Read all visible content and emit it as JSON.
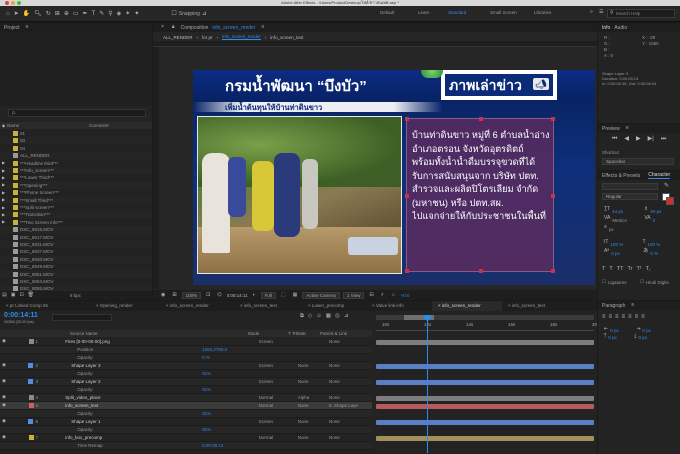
{
  "app": {
    "title": "Adobe After Effects - /Users/ProductDesktop/ไฟล์/ข่าวสนเทศ.aep *"
  },
  "toolbar": {
    "snapping": "Snapping",
    "workspaces": [
      "Default",
      "Learn",
      "Standard",
      "Small Screen",
      "Libraries"
    ],
    "active_workspace": "Standard",
    "search_placeholder": "Search Help"
  },
  "project": {
    "title": "Project",
    "search_placeholder": "ρ.",
    "col_name": "Name",
    "col_comment": "Comment",
    "items": [
      {
        "name": "01",
        "color": "#c9b23a"
      },
      {
        "name": "03",
        "color": "#c9b23a"
      },
      {
        "name": "04",
        "color": "#c9b23a"
      },
      {
        "name": "ALL_RENDER",
        "color": "#9a9a9a"
      },
      {
        "name": "***Headline third***",
        "color": "#c9b23a"
      },
      {
        "name": "***Info_screen***",
        "color": "#c9b23a"
      },
      {
        "name": "***Lower Third***",
        "color": "#c9b23a"
      },
      {
        "name": "***Opening***",
        "color": "#c9b23a"
      },
      {
        "name": "***Phone Screen***",
        "color": "#c9b23a"
      },
      {
        "name": "***Small Third***",
        "color": "#c9b23a"
      },
      {
        "name": "***Split screen***",
        "color": "#c9b23a"
      },
      {
        "name": "***Transition***",
        "color": "#c9b23a"
      },
      {
        "name": "***Two Screen info***",
        "color": "#c9b23a"
      },
      {
        "name": "DSC_8015.MOV",
        "color": "#9a9a9a"
      },
      {
        "name": "DSC_8017.MOV",
        "color": "#9a9a9a"
      },
      {
        "name": "DSC_8031.MOV",
        "color": "#9a9a9a"
      },
      {
        "name": "DSC_8037.MOV",
        "color": "#9a9a9a"
      },
      {
        "name": "DSC_8040.MOV",
        "color": "#9a9a9a"
      },
      {
        "name": "DSC_8049.MOV",
        "color": "#9a9a9a"
      },
      {
        "name": "DSC_8051.MOV",
        "color": "#9a9a9a"
      },
      {
        "name": "DSC_8053.MOV",
        "color": "#9a9a9a"
      },
      {
        "name": "DSC_8055.MOV",
        "color": "#9a9a9a"
      }
    ],
    "footer_bpc": "8 bpc"
  },
  "composition": {
    "title": "Composition",
    "name": "info_screen_render",
    "breadcrumbs": [
      "ALL_RENDER",
      "for pr",
      "info_screen_render",
      "info_screen_text"
    ],
    "zoom": "100%",
    "timecode": "0:00:14:11",
    "quality": "Full",
    "camera": "Active Camera",
    "views": "1 View",
    "exposure": "+0.0"
  },
  "news": {
    "headline": "กรมน้ำพัฒนา “บึงบัว”",
    "subheadline": "เพิ่มน้ำต้นทุนให้บ้านท่าดินขาว",
    "tag": "ภาพเล่าข่าว",
    "body": [
      "บ้านท่าดินขาว หมู่ที่ 6 ตำบลน้ำอ่าง",
      "อำเภอตรอน จังหวัดอุตรดิตถ์",
      "พร้อมทั้งน้ำน้ำดื่มบรรจุขวดที่ได้",
      "รับการสนับสนุนจาก บริษัท ปตท.",
      "สำรวจและผลิตปิโตรเลียม จำกัด",
      "(มหาชน) หรือ ปตท.สผ.",
      "ไปแจกจ่ายให้กับประชาชนในพื้นที่"
    ]
  },
  "info": {
    "title": "Info",
    "tab2": "Audio",
    "readouts": [
      "R :",
      "G :",
      "B :",
      "A : 0",
      "X : -28",
      "Y : 1060"
    ],
    "layer_lines": [
      "Shape Layer 3",
      "Duration: 0:00:05:13",
      "In: 0:00:00:16, Out: 0:00:06:04"
    ]
  },
  "preview": {
    "title": "Preview",
    "shortcut_label": "Shortcut",
    "shortcut_value": "Spacebar"
  },
  "character": {
    "tab1": "Effects & Presets",
    "tab2": "Character",
    "font_style": "Regular",
    "size_value": "44 px",
    "leading_value": "60 px",
    "kerning_value": "Metrics",
    "tracking_value": "0",
    "stroke_value": "px",
    "vscale": "100 %",
    "hscale": "100 %",
    "baseline": "0 px",
    "tsume": "0 %",
    "style_buttons": [
      "T",
      "T",
      "TT",
      "Tr",
      "T¹",
      "T,"
    ],
    "ligatures": "Ligatures",
    "hindi_digits": "Hindi Digits"
  },
  "paragraph": {
    "title": "Paragraph",
    "indent_values": [
      "0 px",
      "0 px",
      "0 px",
      "0 px"
    ]
  },
  "timeline": {
    "tabs": [
      "pr Linked Comp 06",
      "Opening_render",
      "info_screen_render",
      "info_screen_text",
      "Lower_precomp",
      "Value link info",
      "info_screen_render",
      "info_screen_text"
    ],
    "active_tab": "info_screen_render",
    "timecode": "0:00:14:11",
    "frame_info": "00356 (25.00 fps)",
    "headers": {
      "source": "Source Name",
      "mode": "Mode",
      "trkmat": "T  TrkMat",
      "parent": "Parent & Link"
    },
    "ruler": [
      "10s",
      "12s",
      "14s",
      "16s",
      "18s",
      "20s"
    ],
    "layers": [
      {
        "num": "1",
        "name": "Fires [0-00-00-00].png",
        "mode": "Screen",
        "trk": "",
        "parent": "None",
        "indent": 0,
        "color": "#8a8a8a"
      },
      {
        "num": "",
        "name": "Position",
        "mode": "",
        "trk": "",
        "parent": "",
        "indent": 2,
        "value": "1264,2760.0",
        "color": ""
      },
      {
        "num": "",
        "name": "Opacity",
        "mode": "",
        "trk": "",
        "parent": "",
        "indent": 2,
        "value": "0 %",
        "color": ""
      },
      {
        "num": "2",
        "name": "Shape Layer 3",
        "mode": "Screen",
        "trk": "None",
        "parent": "None",
        "indent": 1,
        "color": "#4f8fdc"
      },
      {
        "num": "",
        "name": "Opacity",
        "mode": "",
        "trk": "",
        "parent": "",
        "indent": 2,
        "value": "91%",
        "color": ""
      },
      {
        "num": "3",
        "name": "Shape Layer 2",
        "mode": "Screen",
        "trk": "None",
        "parent": "None",
        "indent": 1,
        "color": "#4f8fdc"
      },
      {
        "num": "",
        "name": "Opacity",
        "mode": "",
        "trk": "",
        "parent": "",
        "indent": 2,
        "value": "91%",
        "color": ""
      },
      {
        "num": "4",
        "name": "Split_video_place",
        "mode": "Normal",
        "trk": "Alpha",
        "parent": "None",
        "indent": 0,
        "color": "#8a8a8a"
      },
      {
        "num": "5",
        "name": "info_screen_text",
        "mode": "Normal",
        "trk": "None",
        "parent": "6. Shape Laye",
        "indent": 0,
        "color": "#d06060"
      },
      {
        "num": "",
        "name": "Opacity",
        "mode": "",
        "trk": "",
        "parent": "",
        "indent": 2,
        "value": "91%",
        "color": ""
      },
      {
        "num": "6",
        "name": "Shape Layer 1",
        "mode": "Screen",
        "trk": "None",
        "parent": "None",
        "indent": 1,
        "color": "#4f8fdc"
      },
      {
        "num": "",
        "name": "Opacity",
        "mode": "",
        "trk": "",
        "parent": "",
        "indent": 2,
        "value": "91%",
        "color": ""
      },
      {
        "num": "7",
        "name": "info_box_precomp",
        "mode": "Normal",
        "trk": "None",
        "parent": "None",
        "indent": 0,
        "color": "#c9b23a"
      },
      {
        "num": "",
        "name": "Time Remap",
        "mode": "",
        "trk": "",
        "parent": "",
        "indent": 2,
        "value": "0:00:09:12",
        "color": ""
      }
    ]
  },
  "colors": {
    "accent": "#2d8ceb",
    "news_blue": "#0b2a78",
    "box_purple": "#5a2d5e",
    "handle_red": "#c8324a"
  }
}
